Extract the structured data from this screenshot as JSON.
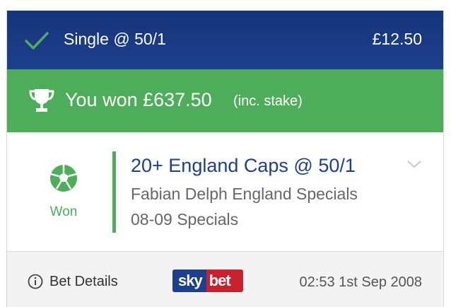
{
  "header": {
    "title": "Single @ 50/1",
    "stake": "£12.50",
    "icon": "check-icon"
  },
  "win_banner": {
    "text": "You won £637.50",
    "note": "(inc. stake)",
    "icon": "trophy-icon"
  },
  "selection": {
    "status": "Won",
    "status_icon": "football-icon",
    "name": "20+ England Caps @ 50/1",
    "market": "Fabian Delph England Specials",
    "event": "08-09 Specials"
  },
  "footer": {
    "details_label": "Bet Details",
    "logo_sky": "sky",
    "logo_bet": "bet",
    "datetime": "02:53 1st Sep 2008"
  },
  "colors": {
    "header_blue": "#1d3f8d",
    "win_green": "#4dad5a",
    "sky_red": "#c8202f"
  }
}
